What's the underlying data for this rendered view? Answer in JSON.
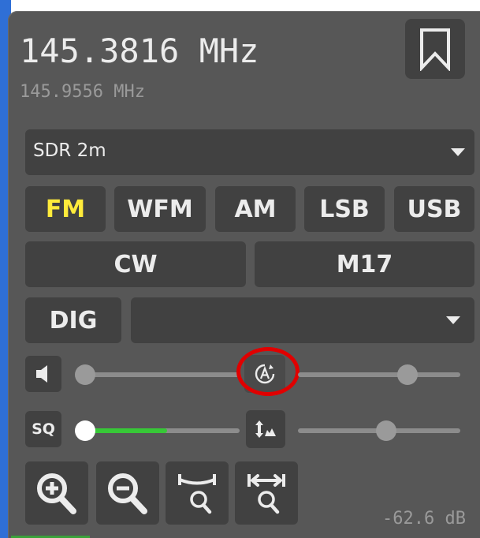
{
  "receiver": {
    "frequency_main": "145.3816 MHz",
    "frequency_secondary": "145.9556 MHz"
  },
  "profile": {
    "selected": "SDR 2m"
  },
  "modes": {
    "fm": "FM",
    "wfm": "WFM",
    "am": "AM",
    "lsb": "LSB",
    "usb": "USB",
    "cw": "CW",
    "m17": "M17",
    "dig": "DIG",
    "active": "FM",
    "dig_selected": ""
  },
  "audio": {
    "volume_level": 0.0,
    "squelch_label": "SQ",
    "squelch_level": 0.0,
    "squelch_signal_fill": 0.55
  },
  "processing": {
    "auto_value_level": 0.7,
    "gain_level": 0.55
  },
  "readout": {
    "level": "-62.6 dB"
  },
  "colors": {
    "panel": "#575757",
    "button": "#414141",
    "active_mode": "#ffeb3b",
    "squelch_fill": "#37c837",
    "highlight": "#e00000"
  },
  "icons": {
    "bookmark": "bookmark-icon",
    "speaker": "speaker-icon",
    "auto": "auto-adjust-icon",
    "gain": "gain-adjust-icon",
    "zoom_in": "zoom-in-icon",
    "zoom_out": "zoom-out-icon",
    "zoom_band": "zoom-band-icon",
    "zoom_fit": "zoom-fit-icon"
  }
}
